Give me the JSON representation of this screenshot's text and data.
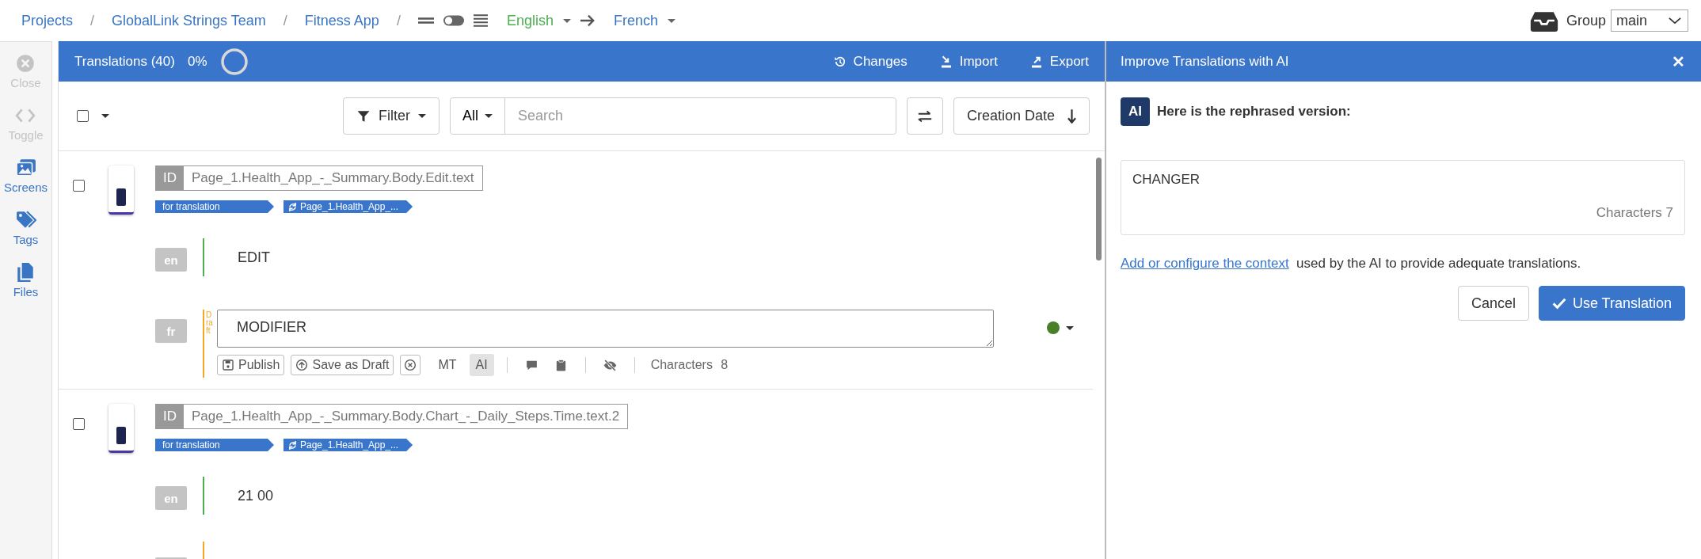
{
  "breadcrumbs": [
    {
      "label": "Projects",
      "separator": "/"
    },
    {
      "label": "GlobalLink Strings Team",
      "separator": "/"
    },
    {
      "label": "Fitness App",
      "separator": "/"
    }
  ],
  "view_toggle": {
    "on": false
  },
  "languages": {
    "source": "English",
    "target": "French"
  },
  "group": {
    "label": "Group",
    "value": "main"
  },
  "sidebar": {
    "items": [
      {
        "label": "Close",
        "disabled": true
      },
      {
        "label": "Toggle",
        "disabled": true
      },
      {
        "label": "Screens",
        "disabled": false
      },
      {
        "label": "Tags",
        "disabled": false
      },
      {
        "label": "Files",
        "disabled": false
      }
    ]
  },
  "translations": {
    "title": "Translations (40)",
    "progress": "0%",
    "actions": [
      {
        "label": "Changes"
      },
      {
        "label": "Import"
      },
      {
        "label": "Export"
      }
    ]
  },
  "toolbar": {
    "select_all_checked": false,
    "filter": "Filter",
    "scope": "All",
    "search_placeholder": "Search",
    "sort": "Creation Date"
  },
  "entries": [
    {
      "checked": false,
      "id_label": "ID",
      "id": "Page_1.Health_App_-_Summary.Body.Edit.text",
      "tags": [
        {
          "label": "for translation",
          "kind": "status"
        },
        {
          "label": "Page_1.Health_App_...",
          "kind": "link"
        }
      ],
      "source": {
        "lang": "en",
        "text": "EDIT"
      },
      "target": {
        "lang": "fr",
        "state": "Draft",
        "text": "MODIFIER",
        "color": "#4a7f2a",
        "actions": [
          {
            "kind": "publish",
            "label": "Publish"
          },
          {
            "kind": "draft",
            "label": "Save as Draft"
          },
          {
            "kind": "discard"
          },
          {
            "kind": "toggle",
            "label": "MT",
            "selected": false
          },
          {
            "kind": "toggle",
            "label": "AI",
            "selected": true
          },
          {
            "kind": "separator"
          },
          {
            "kind": "comment"
          },
          {
            "kind": "clipboard"
          },
          {
            "kind": "separator"
          },
          {
            "kind": "visibility"
          },
          {
            "kind": "separator"
          },
          {
            "kind": "text",
            "label": "Characters 8"
          }
        ]
      }
    },
    {
      "checked": false,
      "id_label": "ID",
      "id": "Page_1.Health_App_-_Summary.Body.Chart_-_Daily_Steps.Time.text.2",
      "tags": [
        {
          "label": "for translation",
          "kind": "status"
        },
        {
          "label": "Page_1.Health_App_...",
          "kind": "link"
        }
      ],
      "source": {
        "lang": "en",
        "text": "21 00"
      }
    }
  ],
  "ai_panel": {
    "title": "Improve Translations with AI",
    "close": "✕",
    "badge": "AI",
    "heading": "Here is the rephrased version:",
    "result": "CHANGER",
    "characters": "Characters 7",
    "context_link": "Add or configure the context",
    "context_text": "used by the AI to provide adequate translations.",
    "buttons": [
      {
        "label": "Cancel",
        "kind": "secondary"
      },
      {
        "label": "Use Translation",
        "kind": "primary"
      }
    ]
  }
}
